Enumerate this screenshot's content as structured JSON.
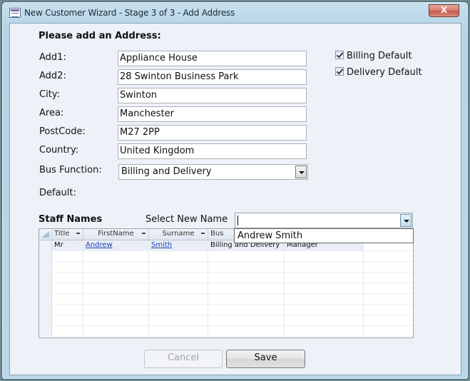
{
  "window": {
    "title": "New Customer Wizard - Stage 3 of 3 - Add Address",
    "close_label": "X"
  },
  "form": {
    "heading": "Please add an Address:",
    "fields": [
      {
        "label": "Add1:",
        "value": "Appliance House"
      },
      {
        "label": "Add2:",
        "value": "28 Swinton Business Park"
      },
      {
        "label": "City:",
        "value": "Swinton"
      },
      {
        "label": "Area:",
        "value": "Manchester"
      },
      {
        "label": "PostCode:",
        "value": "M27 2PP"
      },
      {
        "label": "Country:",
        "value": "United Kingdom"
      }
    ],
    "bus_function": {
      "label": "Bus Function:",
      "value": "Billing and Delivery"
    },
    "default_label": "Default:",
    "checkboxes": [
      {
        "label": "Billing Default",
        "checked": true
      },
      {
        "label": "Delivery Default",
        "checked": true
      }
    ]
  },
  "staff": {
    "heading": "Staff Names",
    "select_label": "Select New Name",
    "select_value": "",
    "dropdown_options": [
      "Andrew Smith"
    ],
    "grid": {
      "columns": [
        "Title",
        "FirstName",
        "Surname",
        "Bus"
      ],
      "rows": [
        {
          "title": "Mr",
          "first": "Andrew",
          "surname": "Smith",
          "bus": "Billing and Delivery",
          "role": "Manager"
        }
      ]
    }
  },
  "buttons": {
    "cancel": "Cancel",
    "save": "Save"
  }
}
